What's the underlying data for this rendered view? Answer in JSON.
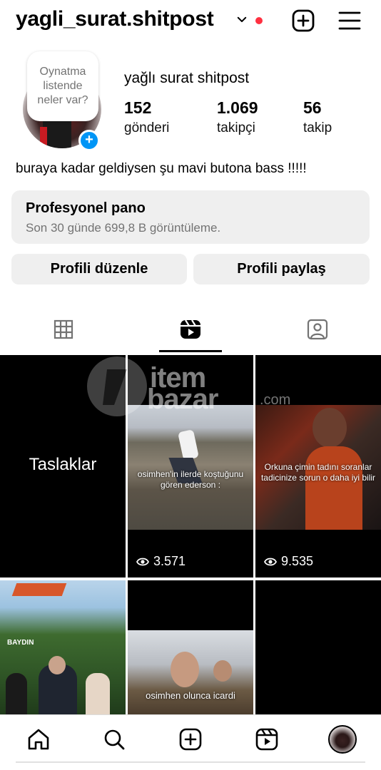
{
  "header": {
    "username": "yagli_surat.shitpost",
    "has_notification_dot": true
  },
  "profile": {
    "note_bubble": "Oynatma listende neler var?",
    "display_name": "yağlı surat shitpost",
    "stats": [
      {
        "value": "152",
        "label": "gönderi"
      },
      {
        "value": "1.069",
        "label": "takipçi"
      },
      {
        "value": "56",
        "label": "takip"
      }
    ],
    "bio": "buraya kadar geldiysen şu mavi butona bass !!!!!"
  },
  "pro_dashboard": {
    "title": "Profesyonel pano",
    "subtitle": "Son 30 günde 699,8 B görüntüleme."
  },
  "actions": {
    "edit_label": "Profili düzenle",
    "share_label": "Profili paylaş"
  },
  "tabs": {
    "active": "reels"
  },
  "grid": {
    "drafts_label": "Taslaklar",
    "items": [
      {
        "caption": "osimhen'in ilerde koştuğunu gören ederson :",
        "views": "3.571"
      },
      {
        "caption": "Orkuna çimin tadını soranlar tadicinize sorun o daha iyi bilir",
        "views": "9.535"
      },
      {
        "caption": "BAYDIN",
        "views": ""
      },
      {
        "caption": "osimhen olunca icardi",
        "views": ""
      },
      {
        "caption": "",
        "views": ""
      }
    ]
  },
  "watermark": {
    "line1": "item",
    "line2": "bazar",
    "line3": ".com"
  },
  "colors": {
    "accent": "#0095f6",
    "notification": "#ff3040",
    "button_bg": "#efefef",
    "muted_text": "#737373"
  }
}
